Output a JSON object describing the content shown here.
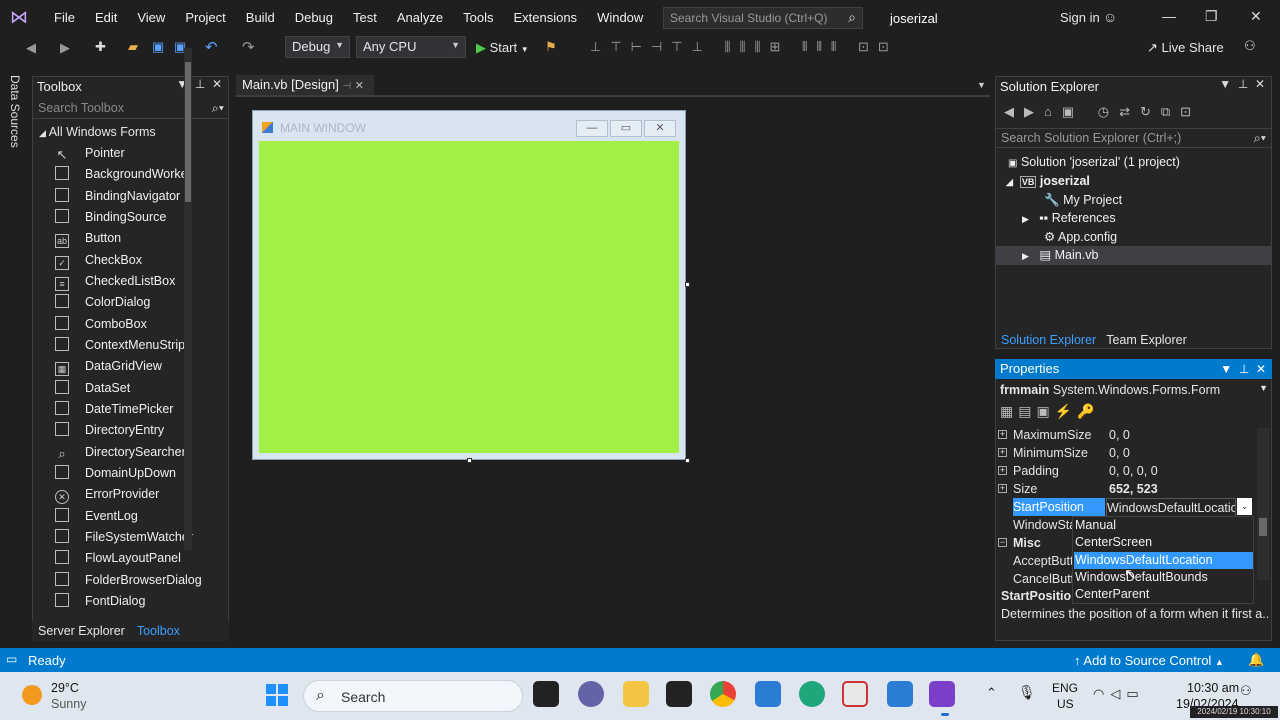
{
  "titlebar": {
    "menu": [
      "File",
      "Edit",
      "View",
      "Project",
      "Build",
      "Debug",
      "Test",
      "Analyze",
      "Tools",
      "Extensions",
      "Window",
      "Help"
    ],
    "search_placeholder": "Search Visual Studio (Ctrl+Q)",
    "solution_name": "joserizal",
    "sign_in": "Sign in"
  },
  "toolbar": {
    "config": "Debug",
    "platform": "Any CPU",
    "start": "Start",
    "live_share": "Live Share"
  },
  "left_strip": {
    "data_sources": "Data Sources"
  },
  "toolbox": {
    "title": "Toolbox",
    "search_placeholder": "Search Toolbox",
    "group": "All Windows Forms",
    "items": [
      "Pointer",
      "BackgroundWorker",
      "BindingNavigator",
      "BindingSource",
      "Button",
      "CheckBox",
      "CheckedListBox",
      "ColorDialog",
      "ComboBox",
      "ContextMenuStrip",
      "DataGridView",
      "DataSet",
      "DateTimePicker",
      "DirectoryEntry",
      "DirectorySearcher",
      "DomainUpDown",
      "ErrorProvider",
      "EventLog",
      "FileSystemWatcher",
      "FlowLayoutPanel",
      "FolderBrowserDialog",
      "FontDialog"
    ],
    "tab_server": "Server Explorer",
    "tab_toolbox": "Toolbox"
  },
  "editor": {
    "tab": "Main.vb [Design]",
    "form_title": "MAIN WINDOW",
    "form_color": "#a2ef46"
  },
  "solution_explorer": {
    "title": "Solution Explorer",
    "search_placeholder": "Search Solution Explorer (Ctrl+;)",
    "solution": "Solution 'joserizal' (1 project)",
    "project": "joserizal",
    "nodes": [
      "My Project",
      "References",
      "App.config",
      "Main.vb"
    ],
    "tab_solution": "Solution Explorer",
    "tab_team": "Team Explorer"
  },
  "properties": {
    "title": "Properties",
    "object": "frmmain",
    "object_type": "System.Windows.Forms.Form",
    "rows": [
      {
        "name": "MaximumSize",
        "value": "0, 0"
      },
      {
        "name": "MinimumSize",
        "value": "0, 0"
      },
      {
        "name": "Padding",
        "value": "0, 0, 0, 0"
      },
      {
        "name": "Size",
        "value": "652, 523"
      },
      {
        "name": "StartPosition",
        "value": "WindowsDefaultLocation"
      },
      {
        "name": "WindowSta",
        "value": ""
      },
      {
        "name": "Misc",
        "value": ""
      },
      {
        "name": "AcceptButt",
        "value": ""
      },
      {
        "name": "CancelButt",
        "value": ""
      }
    ],
    "dropdown": [
      "Manual",
      "CenterScreen",
      "WindowsDefaultLocation",
      "WindowsDefaultBounds",
      "CenterParent"
    ],
    "desc_title": "StartPositior",
    "desc_text": "Determines the position of a form when it first a..."
  },
  "statusbar": {
    "ready": "Ready",
    "source_control": "Add to Source Control"
  },
  "taskbar": {
    "temp": "29°C",
    "weather": "Sunny",
    "search": "Search",
    "lang1": "ENG",
    "lang2": "US",
    "time": "10:30 am",
    "date": "19/02/2024",
    "timestamp": "2024/02/19 10:30:10"
  }
}
